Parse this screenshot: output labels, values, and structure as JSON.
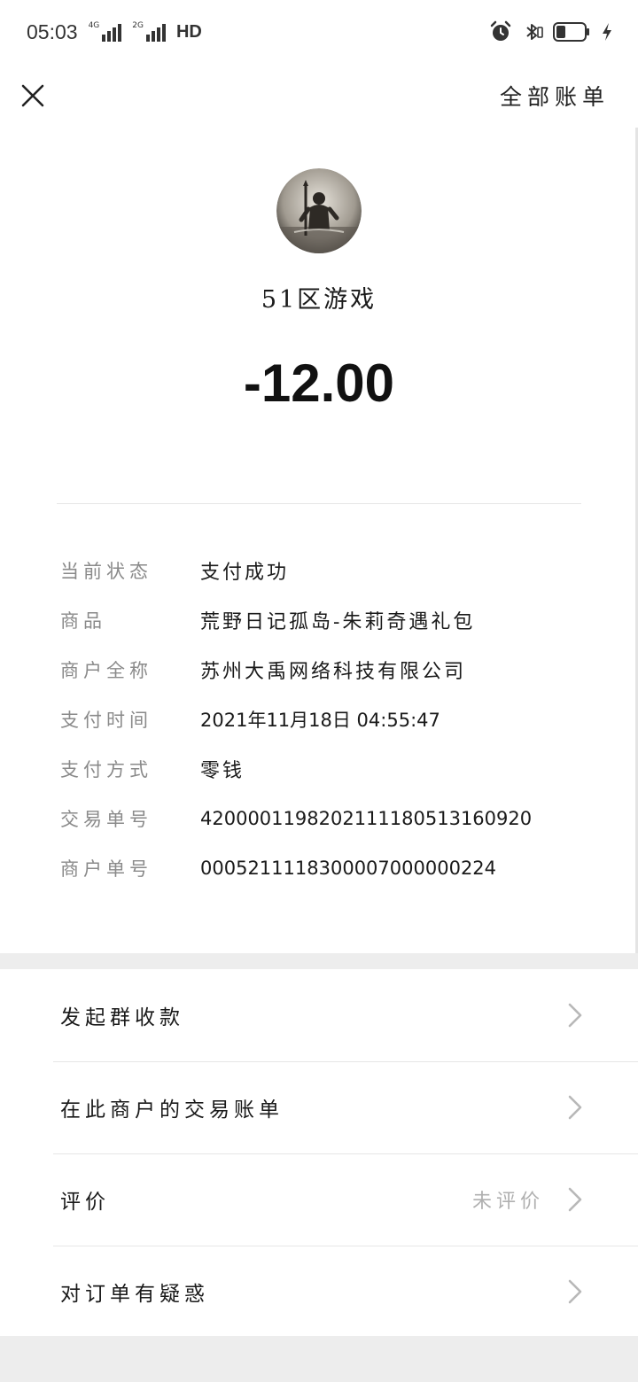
{
  "status_bar": {
    "time": "05:03",
    "network_tags": [
      "4G",
      "2G"
    ],
    "hd_label": "HD",
    "icons": [
      "alarm-icon",
      "bluetooth-icon",
      "battery-icon",
      "charging-icon"
    ]
  },
  "nav": {
    "close_icon": "close-icon",
    "all_bills_label": "全部账单"
  },
  "transaction": {
    "merchant": "51区游戏",
    "amount": "-12.00",
    "details": [
      {
        "label": "当前状态",
        "value": "支付成功"
      },
      {
        "label": "商品",
        "value": "荒野日记孤岛-朱莉奇遇礼包"
      },
      {
        "label": "商户全称",
        "value": "苏州大禹网络科技有限公司"
      },
      {
        "label": "支付时间",
        "value": "2021年11月18日 04:55:47"
      },
      {
        "label": "支付方式",
        "value": "零钱"
      },
      {
        "label": "交易单号",
        "value": "4200001198202111180513160920"
      },
      {
        "label": "商户单号",
        "value": "0005211118300007000000224"
      }
    ]
  },
  "actions": [
    {
      "label": "发起群收款",
      "extra": ""
    },
    {
      "label": "在此商户的交易账单",
      "extra": ""
    },
    {
      "label": "评价",
      "extra": "未评价"
    },
    {
      "label": "对订单有疑惑",
      "extra": ""
    }
  ],
  "colors": {
    "background": "#ededed",
    "card": "#ffffff",
    "label_gray": "#8a8a8a",
    "hint_gray": "#b0b0b0",
    "text": "#1a1a1a"
  }
}
